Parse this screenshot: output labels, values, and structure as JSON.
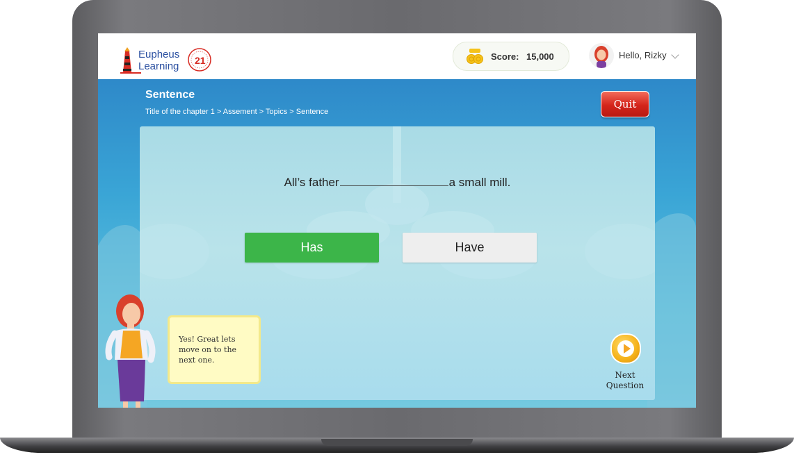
{
  "header": {
    "logo_line1": "Eupheus",
    "logo_line2": "Learning",
    "score_label": "Score:",
    "score_value": "15,000",
    "greeting": "Hello, Rizky"
  },
  "page": {
    "title": "Sentence",
    "breadcrumb": "Title of the chapter 1 > Assement > Topics > Sentence",
    "quit_label": "Quit"
  },
  "question": {
    "before": "All’s father",
    "after": "a small mill.",
    "options": [
      {
        "label": "Has",
        "state": "selected-correct"
      },
      {
        "label": "Have",
        "state": "unselected"
      }
    ]
  },
  "feedback": {
    "message": "Yes! Great lets move on to the next one."
  },
  "next": {
    "line1": "Next",
    "line2": "Question"
  },
  "icons": {
    "score": "coin-stack-icon",
    "user_menu": "chevron-down-icon",
    "next": "play-icon"
  },
  "colors": {
    "correct": "#3cb549",
    "quit": "#d4251b",
    "header": "#ffffff",
    "accent_blue": "#2e89c9"
  }
}
